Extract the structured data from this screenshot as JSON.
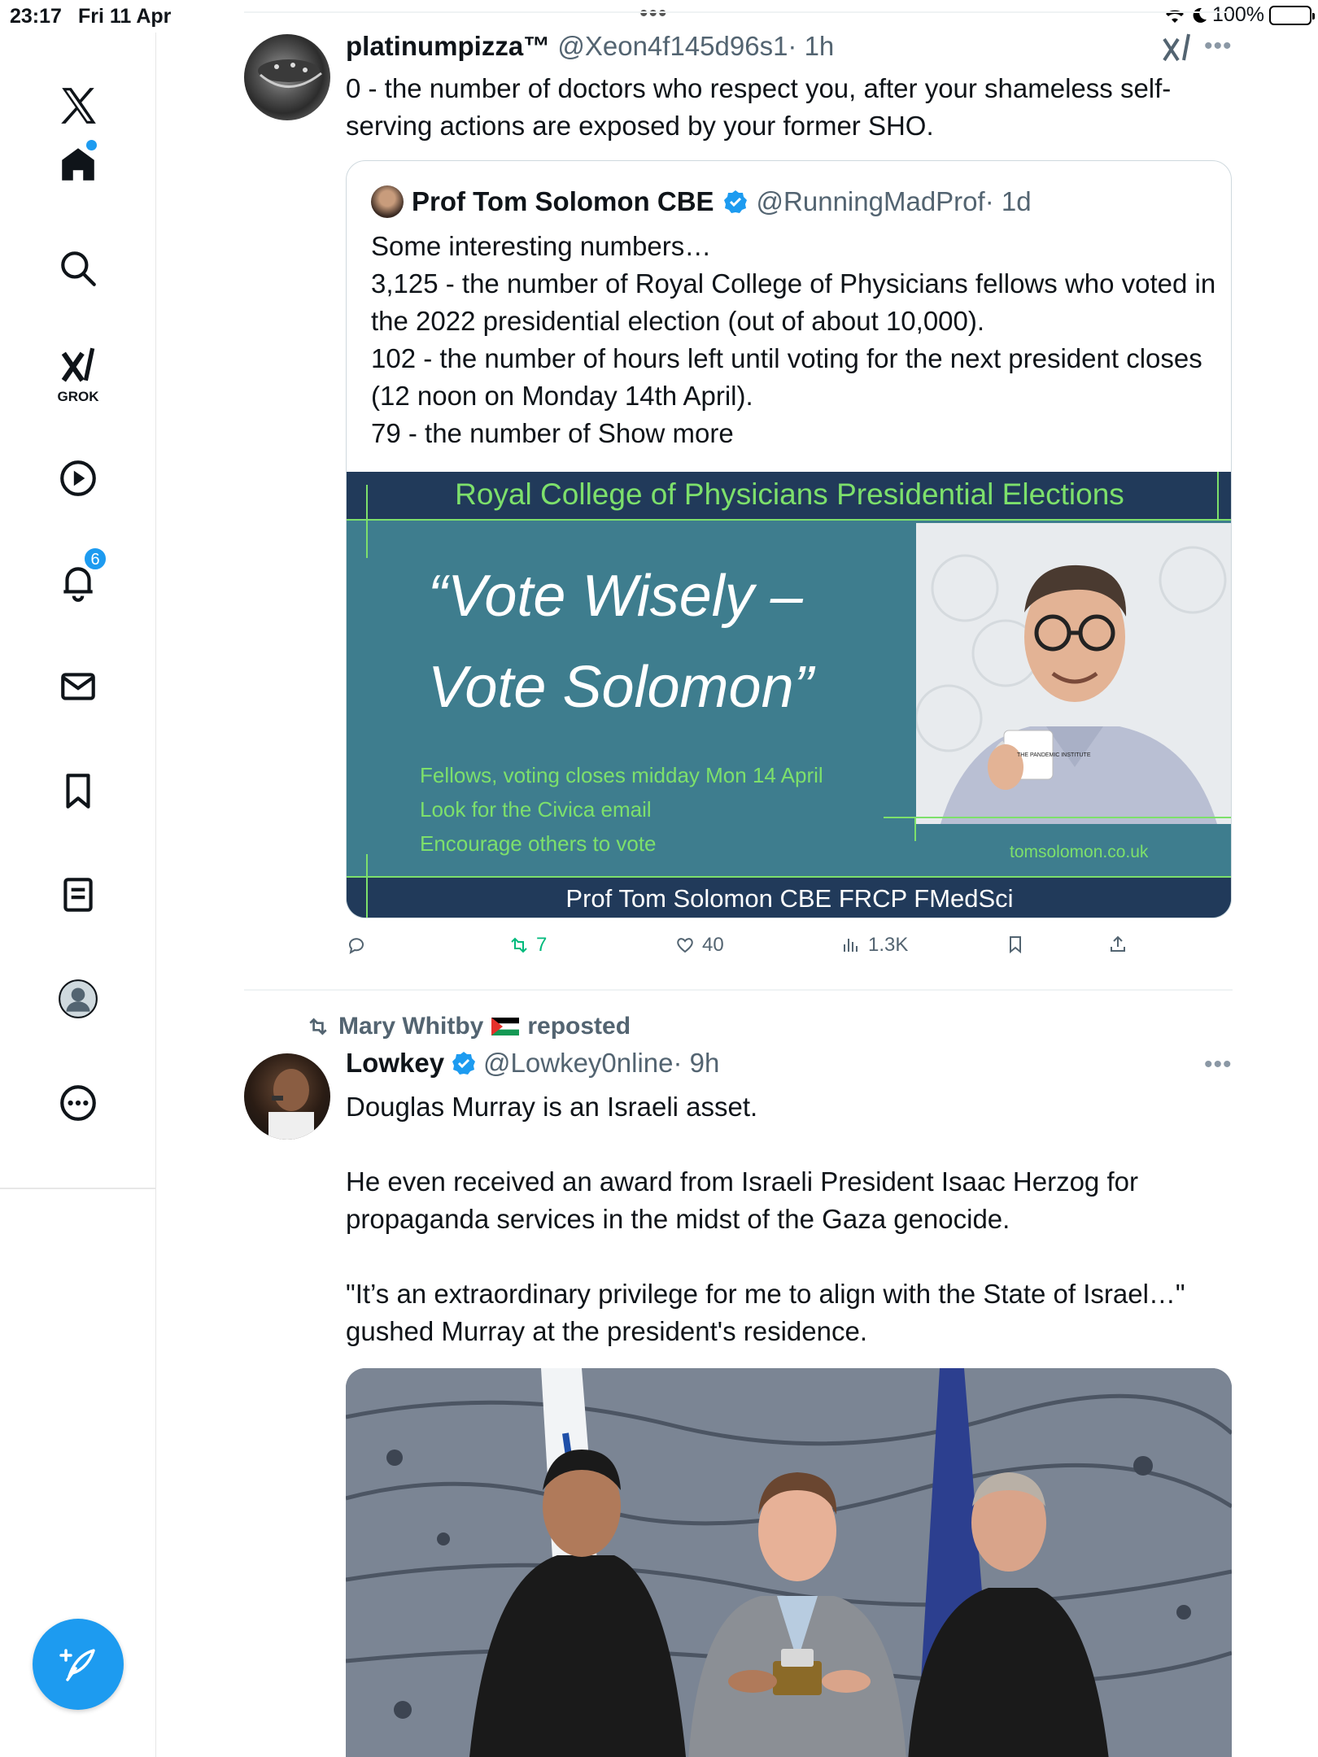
{
  "status_bar": {
    "time": "23:17",
    "date": "Fri 11 Apr",
    "battery": "100%"
  },
  "sidebar": {
    "items": [
      {
        "name": "home",
        "icon": "home-icon"
      },
      {
        "name": "search",
        "icon": "search-icon"
      },
      {
        "name": "grok",
        "icon": "grok-icon",
        "label": "GROK"
      },
      {
        "name": "video",
        "icon": "play-icon"
      },
      {
        "name": "notifications",
        "icon": "bell-icon",
        "badge": "6"
      },
      {
        "name": "messages",
        "icon": "mail-icon"
      },
      {
        "name": "bookmarks",
        "icon": "bookmark-icon"
      },
      {
        "name": "lists",
        "icon": "list-icon"
      },
      {
        "name": "profile",
        "icon": "avatar-icon"
      },
      {
        "name": "more",
        "icon": "more-icon"
      }
    ],
    "compose_icon": "compose-icon"
  },
  "tweet1": {
    "name": "platinumpizza™",
    "handle": "@Xeon4f145d96s1",
    "time": "· 1h",
    "text": "0 - the number of doctors who respect you, after your shameless self-serving actions are exposed by your former SHO.",
    "quote": {
      "name": "Prof Tom Solomon CBE",
      "handle": "@RunningMadProf",
      "time": "· 1d",
      "lines": [
        "Some interesting numbers…",
        "3,125 - the number of Royal College of Physicians fellows who voted in the 2022 presidential election  (out of about 10,000).",
        "102 - the number of hours left until voting for the next president closes (12 noon on Monday 14th April).",
        "79 - the number of "
      ],
      "show_more": "Show more",
      "banner": {
        "top": "Royal College of  Physicians Presidential  Elections",
        "slogan1": "“Vote Wisely –",
        "slogan2": "Vote Solomon”",
        "line1": "Fellows, voting closes midday Mon  14 April",
        "line2": "Look for the Civica email",
        "line3": "Encourage others to vote",
        "url": "tomsolomon.co.uk",
        "bottom": "Prof  Tom  Solomon  CBE  FRCP  FMedSci",
        "mug_text": "THE PANDEMIC INSTITUTE"
      }
    },
    "actions": {
      "retweets": "7",
      "likes": "40",
      "views": "1.3K"
    }
  },
  "tweet2": {
    "repost_by": "Mary Whitby",
    "repost_label": "reposted",
    "name": "Lowkey",
    "handle": "@Lowkey0nline",
    "time": "· 9h",
    "p1": "Douglas Murray is an Israeli asset.",
    "p2": "He even received an award from Israeli President Isaac Herzog for propaganda services in the midst of the Gaza genocide.",
    "p3": "\"It’s an extraordinary privilege for me to align with the State of Israel…\" gushed Murray at the president's residence."
  },
  "colors": {
    "accent": "#1d9bf0",
    "retweet_green": "#00ba7c",
    "banner_teal": "#3e7d8e",
    "banner_navy": "#213a5a",
    "banner_green": "#7de06b"
  }
}
